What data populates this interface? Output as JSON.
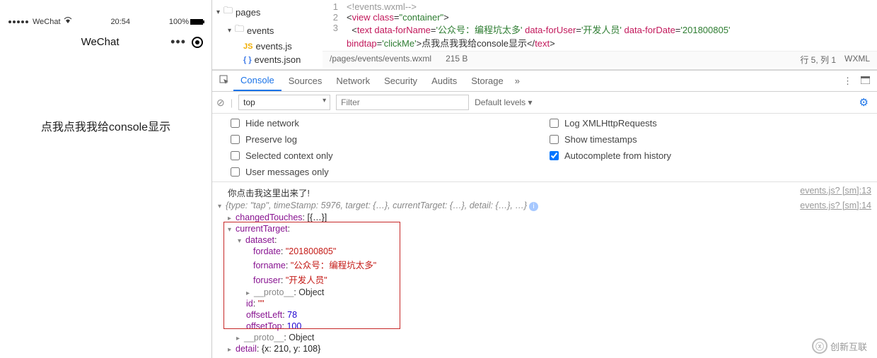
{
  "simulator": {
    "signal_label": "WeChat",
    "time": "20:54",
    "battery": "100%",
    "nav_title": "WeChat",
    "content_text": "点我点我我给console显示"
  },
  "file_tree": {
    "root": "pages",
    "folder": "events",
    "files": [
      {
        "icon": "JS",
        "name": "events.js"
      },
      {
        "icon": "{ }",
        "name": "events.json"
      }
    ]
  },
  "code": {
    "lines": [
      {
        "n": "1",
        "html": "<span class='c-comment'>&lt;!events.wxml--&gt;</span>"
      },
      {
        "n": "2",
        "html": "<span class='c-plain'>&lt;</span><span class='c-attr'>view</span> <span class='c-attr'>class</span>=<span class='c-tag'>\"container\"</span><span class='c-plain'>&gt;</span>"
      },
      {
        "n": "3",
        "html": "  <span class='c-plain'>&lt;</span><span class='c-attr'>text</span> <span class='c-attr'>data-forName</span>=<span class='c-tag'>'公众号：编程坑太多'</span> <span class='c-attr'>data-forUser</span>=<span class='c-tag'>'开发人员'</span> <span class='c-attr'>data-forDate</span>=<span class='c-tag'>'201800805'</span>"
      },
      {
        "n": "",
        "html": "<span class='c-attr'>bindtap</span>=<span class='c-tag'>'clickMe'</span><span class='c-plain'>&gt;</span>点我点我我给console显示<span class='c-plain'>&lt;/</span><span class='c-attr'>text</span><span class='c-plain'>&gt;</span>"
      }
    ]
  },
  "editor_status": {
    "path": "/pages/events/events.wxml",
    "size": "215 B",
    "cursor": "行 5, 列 1",
    "lang": "WXML"
  },
  "devtools": {
    "tabs": [
      "Console",
      "Sources",
      "Network",
      "Security",
      "Audits",
      "Storage"
    ],
    "active_tab": "Console",
    "context_selected": "top",
    "filter_placeholder": "Filter",
    "levels_label": "Default levels",
    "options": [
      {
        "label": "Hide network",
        "checked": false
      },
      {
        "label": "Log XMLHttpRequests",
        "checked": false
      },
      {
        "label": "Preserve log",
        "checked": false
      },
      {
        "label": "Show timestamps",
        "checked": false
      },
      {
        "label": "Selected context only",
        "checked": false
      },
      {
        "label": "Autocomplete from history",
        "checked": true
      },
      {
        "label": "User messages only",
        "checked": false
      }
    ]
  },
  "console_output": {
    "line1_text": "你点击我这里出来了!",
    "line1_src": "events.js? [sm]:13",
    "obj_summary": "{type: \"tap\", timeStamp: 5976, target: {…}, currentTarget: {…}, detail: {…}, …}",
    "obj_src": "events.js? [sm]:14",
    "changedTouches": "changedTouches: [{…}]",
    "currentTarget_label": "currentTarget:",
    "dataset_label": "dataset:",
    "fordate": {
      "k": "fordate",
      "v": "\"201800805\""
    },
    "forname": {
      "k": "forname",
      "v": "\"公众号：编程坑太多\""
    },
    "foruser": {
      "k": "foruser",
      "v": "\"开发人员\""
    },
    "proto1": "__proto__: Object",
    "id": {
      "k": "id",
      "v": "\"\""
    },
    "offsetLeft": {
      "k": "offsetLeft",
      "v": "78"
    },
    "offsetTop": {
      "k": "offsetTop",
      "v": "100"
    },
    "proto2": "__proto__: Object",
    "detail": "detail: {x: 210, y: 108}"
  },
  "watermark": "创新互联"
}
